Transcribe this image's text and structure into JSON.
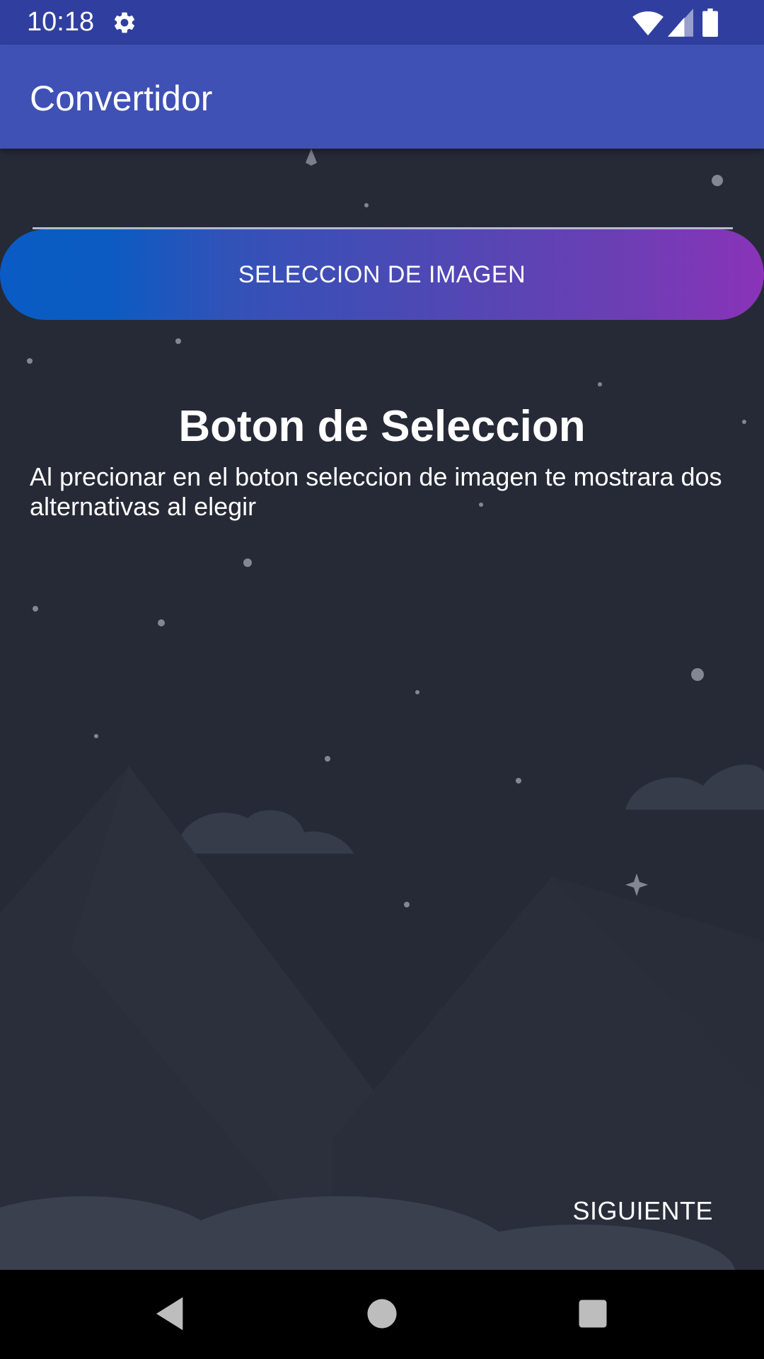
{
  "status_bar": {
    "time": "10:18",
    "icons": [
      "settings-gear-icon",
      "wifi-icon",
      "cell-signal-icon",
      "battery-icon"
    ],
    "background": "#303f9f"
  },
  "app_bar": {
    "title": "Convertidor",
    "background": "#3f51b5"
  },
  "main": {
    "select_button_label": "SELECCION DE IMAGEN",
    "heading": "Boton de Seleccion",
    "description": "Al precionar en el boton seleccion de imagen te mostrara dos alternativas al elegir",
    "next_button_label": "SIGUIENTE",
    "background": "#262a36",
    "button_gradient": [
      "#0a5cc4",
      "#8a33b8"
    ]
  },
  "nav_bar": {
    "buttons": [
      "back-icon",
      "home-icon",
      "recents-icon"
    ]
  }
}
